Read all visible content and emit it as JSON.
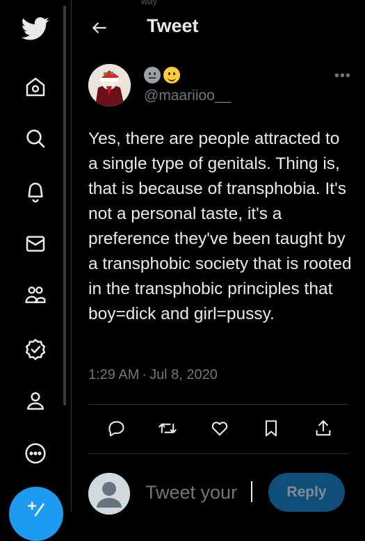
{
  "header": {
    "title": "Tweet",
    "back_icon": "arrow-left-icon",
    "top_fade_text": "way"
  },
  "sidebar": {
    "items": [
      {
        "icon": "twitter-logo-icon"
      },
      {
        "icon": "home-icon"
      },
      {
        "icon": "search-icon"
      },
      {
        "icon": "bell-icon"
      },
      {
        "icon": "mail-icon"
      },
      {
        "icon": "communities-icon"
      },
      {
        "icon": "verified-icon"
      },
      {
        "icon": "profile-icon"
      },
      {
        "icon": "more-circle-icon"
      },
      {
        "icon": "compose-icon"
      }
    ],
    "accent": "#1d9bf0"
  },
  "tweet": {
    "author": {
      "display_name_emojis": [
        "neutral-face-emoji",
        "smiling-face-emoji"
      ],
      "handle": "@maariioo__"
    },
    "more_label": "•••",
    "text": "Yes, there are people attracted to a single type of genitals. Thing is, that is because of transphobia. It's not a personal taste, it's a preference they've been taught by a transphobic society that is rooted in the transphobic principles that boy=dick and girl=pussy.",
    "time": "1:29 AM",
    "separator": "·",
    "date": "Jul 8, 2020"
  },
  "actions": [
    {
      "name": "reply",
      "icon": "reply-icon"
    },
    {
      "name": "retweet",
      "icon": "retweet-icon"
    },
    {
      "name": "like",
      "icon": "heart-icon"
    },
    {
      "name": "bookmark",
      "icon": "bookmark-icon"
    },
    {
      "name": "share",
      "icon": "share-icon"
    }
  ],
  "reply_box": {
    "placeholder": "Tweet your",
    "button_label": "Reply"
  },
  "colors": {
    "background": "#000000",
    "text": "#e7e9ea",
    "muted": "#71767b",
    "border": "#2f3336",
    "accent": "#1d9bf0"
  }
}
